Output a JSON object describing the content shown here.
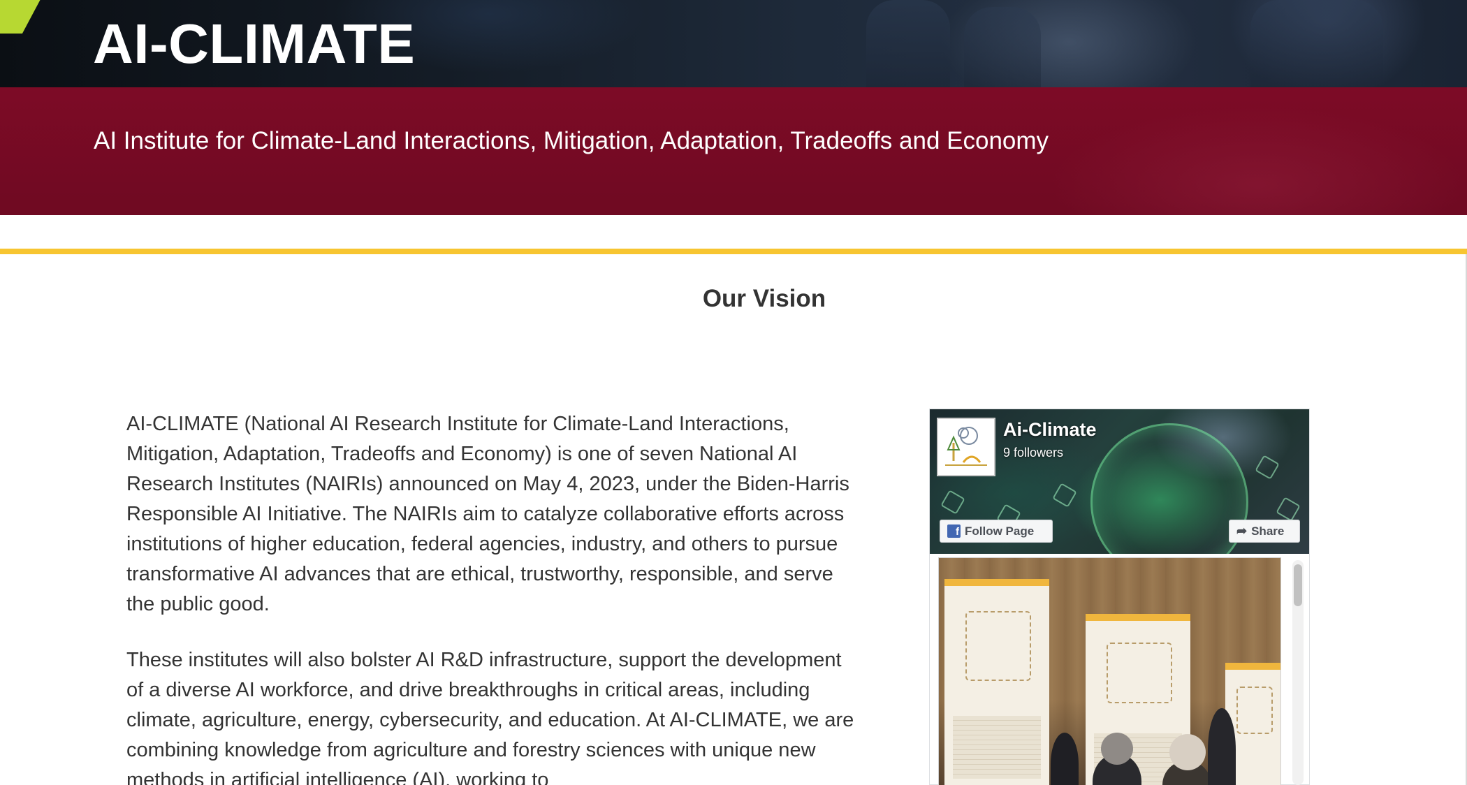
{
  "header": {
    "site_title": "AI-CLIMATE",
    "site_subtitle": "AI Institute for Climate-Land Interactions, Mitigation, Adaptation, Tradeoffs and Economy"
  },
  "colors": {
    "maroon": "#7d0b26",
    "gold": "#f7c531",
    "accent_green": "#b7d832",
    "text": "#333333",
    "facebook_blue": "#4267b2"
  },
  "main": {
    "heading": "Our Vision",
    "paragraphs": [
      "AI-CLIMATE (National AI Research Institute for Climate-Land Interactions, Mitigation, Adaptation, Tradeoffs and Economy) is one of seven National AI Research Institutes (NAIRIs) announced on May 4, 2023, under the Biden-Harris Responsible AI Initiative. The NAIRIs aim to catalyze collaborative efforts across institutions of higher education, federal agencies, industry, and others to pursue transformative AI advances that are ethical, trustworthy, responsible, and serve the public good.",
      "These institutes will also bolster AI R&D infrastructure, support the development of a diverse AI workforce, and drive breakthroughs in critical areas, including climate, agriculture, energy, cybersecurity, and education. At AI-CLIMATE, we are combining knowledge from agriculture and forestry sciences with unique new methods in artificial intelligence (AI), working to"
    ]
  },
  "facebook_widget": {
    "page_name": "Ai-Climate",
    "followers": "9 followers",
    "follow_button": "Follow Page",
    "share_button": "Share",
    "icons": {
      "follow": "facebook-f-icon",
      "share": "share-arrow-icon",
      "logo": "ai-climate-logo"
    }
  }
}
